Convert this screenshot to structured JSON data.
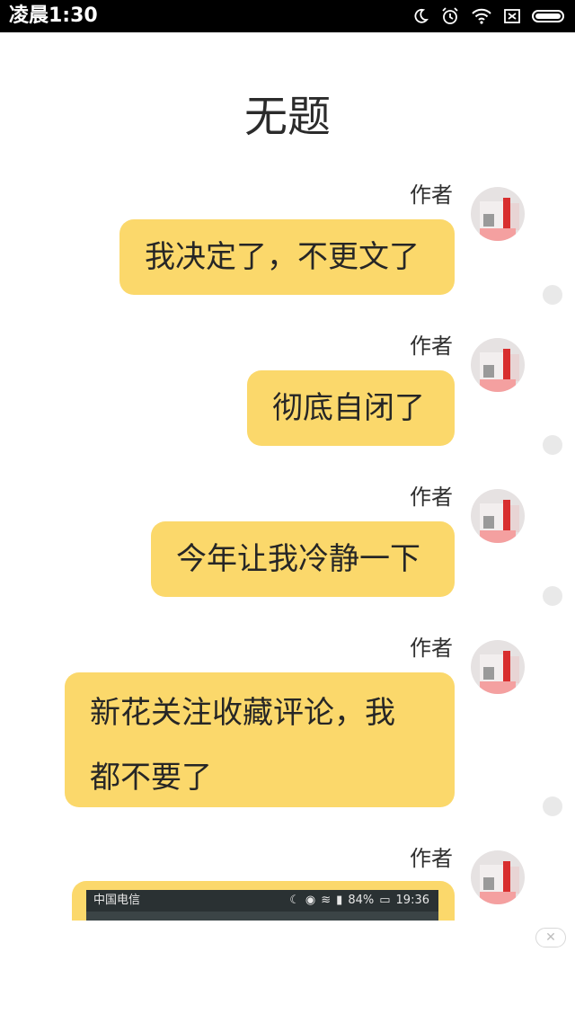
{
  "status_bar": {
    "time": "凌晨1:30",
    "icons": [
      "moon-icon",
      "alarm-icon",
      "wifi-icon",
      "no-sim-icon",
      "battery-icon"
    ]
  },
  "title": "无题",
  "messages": [
    {
      "author": "作者",
      "text": "我决定了，不更文了"
    },
    {
      "author": "作者",
      "text": "彻底自闭了"
    },
    {
      "author": "作者",
      "text": "今年让我冷静一下"
    },
    {
      "author": "作者",
      "line1": "新花关注收藏评论，我",
      "line2": "都不要了"
    },
    {
      "author": "作者"
    }
  ],
  "embedded_screenshot": {
    "carrier": "中国电信",
    "battery": "84%",
    "time": "19:36"
  },
  "colors": {
    "bubble": "#fbd86b",
    "background": "#ffffff",
    "status_bar": "#000000"
  },
  "ad_close_icon": "close-icon"
}
